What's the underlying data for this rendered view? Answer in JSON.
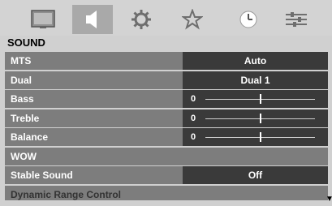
{
  "top_icons": [
    {
      "name": "picture-icon",
      "selected": false
    },
    {
      "name": "sound-icon",
      "selected": true
    },
    {
      "name": "settings-icon",
      "selected": false
    },
    {
      "name": "favorites-icon",
      "selected": false
    },
    {
      "name": "clock-icon",
      "selected": false
    },
    {
      "name": "setup-icon",
      "selected": false
    }
  ],
  "section": {
    "title": "SOUND"
  },
  "menu": {
    "items": [
      {
        "label": "MTS",
        "value": "Auto"
      },
      {
        "label": "Dual",
        "value": "Dual 1"
      },
      {
        "label": "Bass",
        "slider_value": "0",
        "level": 0.5
      },
      {
        "label": "Treble",
        "slider_value": "0",
        "level": 0.5
      },
      {
        "label": "Balance",
        "slider_value": "0",
        "level": 0.5
      },
      {
        "label": "WOW"
      },
      {
        "label": "Stable Sound",
        "value": "Off"
      },
      {
        "label": "Dynamic Range Control"
      }
    ]
  },
  "scroll": {
    "arrow": "▼"
  },
  "colors": {
    "row_bg": "#7d7d7d",
    "value_bg": "#3a3a3a",
    "selected_icon_bg": "#a9a9a9"
  }
}
